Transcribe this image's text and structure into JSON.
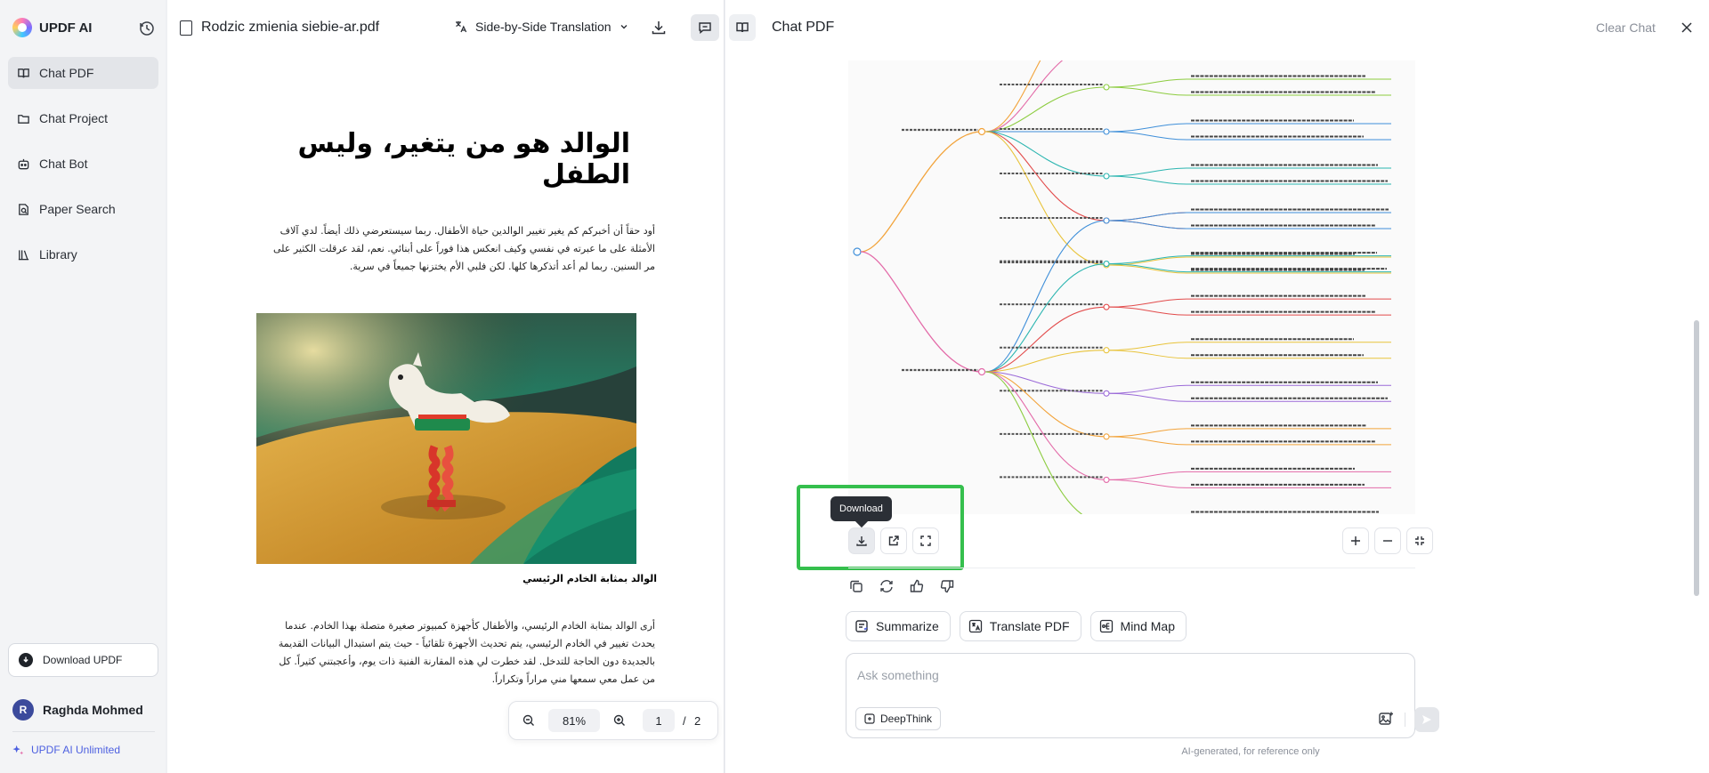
{
  "sidebar": {
    "brand": "UPDF AI",
    "items": [
      {
        "label": "Chat PDF",
        "icon": "book-icon"
      },
      {
        "label": "Chat Project",
        "icon": "folder-icon"
      },
      {
        "label": "Chat Bot",
        "icon": "bot-icon"
      },
      {
        "label": "Paper Search",
        "icon": "paper-search-icon"
      },
      {
        "label": "Library",
        "icon": "library-icon"
      }
    ],
    "download_label": "Download UPDF",
    "user_initial": "R",
    "user_name": "Raghda Mohmed",
    "plan_label": "UPDF AI Unlimited"
  },
  "pdf": {
    "file_name": "Rodzic zmienia siebie-ar.pdf",
    "translate_mode": "Side-by-Side Translation",
    "page_title": "الوالد هو من يتغير، وليس الطفل",
    "para1": "أود حقاً أن أخبركم كم يغير تغيير الوالدين حياة الأطفال. ربما سيستعرضي ذلك أيضاً. لدي آلاف الأمثلة على ما عبرته في نفسي وكيف انعكس هذا فوراً على أبنائي. نعم، لقد عرقلت الكثير على مر السنين. ربما لم أعد أتذكرها كلها. لكن فلبي الأم يختزنها جميعاً في سرية.",
    "caption": "الوالد بمثابة الخادم الرئيسي",
    "para2": "أرى الوالد بمثابة الخادم الرئيسي، والأطفال كأجهزة كمبيوتر صغيرة متصلة بهذا الخادم. عندما يحدث تغيير في الخادم الرئيسي، يتم تحديث الأجهزة تلقائياً - حيث يتم استبدال البيانات القديمة بالجديدة دون الحاجة للتدخل. لقد خطرت لي هذه المقارنة الفنية ذات يوم، وأعجبتني كثيراً. كل من عمل معي سمعها مني مراراً وتكراراً.",
    "zoom": "81%",
    "page_current": "1",
    "page_separator": "/",
    "page_total": "2"
  },
  "chat": {
    "title": "Chat PDF",
    "clear_label": "Clear Chat",
    "tooltip": "Download",
    "quick_actions": [
      {
        "label": "Summarize",
        "icon": "summarize-icon"
      },
      {
        "label": "Translate PDF",
        "icon": "translate-icon"
      },
      {
        "label": "Mind Map",
        "icon": "mindmap-icon"
      }
    ],
    "ask_placeholder": "Ask something",
    "deepthink_label": "DeepThink",
    "footer_note": "AI-generated, for reference only"
  },
  "colors": {
    "accent": "#4c5fe0",
    "highlight": "#35bf4d",
    "mm_orange": "#f2a33a",
    "mm_pink": "#e36aa8",
    "mm_green": "#8ccc3f",
    "mm_blue": "#3f8fd9",
    "mm_teal": "#2bb5b0",
    "mm_red": "#e24b4b",
    "mm_yellow": "#e8c33a",
    "mm_purple": "#9b6ad8"
  }
}
